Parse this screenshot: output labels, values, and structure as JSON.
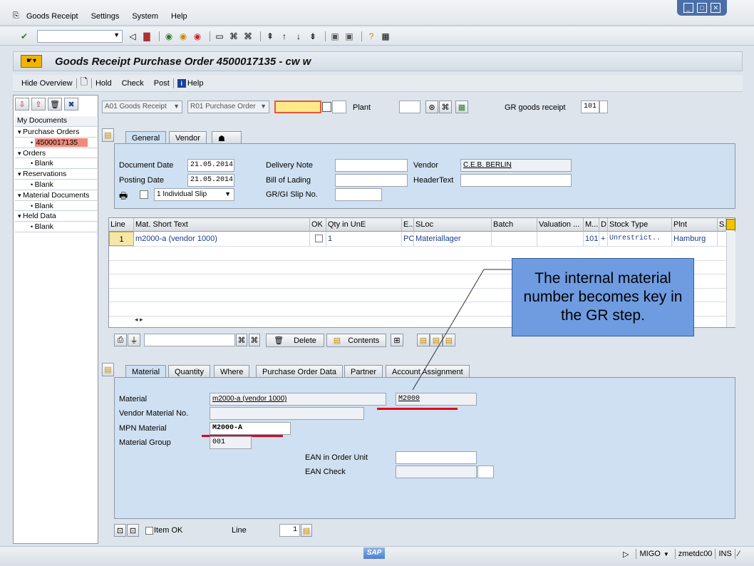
{
  "menu": [
    "Goods Receipt",
    "Settings",
    "System",
    "Help"
  ],
  "title": "Goods Receipt Purchase Order 4500017135 - cw w",
  "app_toolbar": [
    "Hide Overview",
    "Hold",
    "Check",
    "Post",
    "Help"
  ],
  "tree": {
    "title": "My Documents",
    "items": [
      {
        "label": "Purchase Orders",
        "level": 0
      },
      {
        "label": "4500017135",
        "level": 1,
        "selected": true
      },
      {
        "label": "Orders",
        "level": 0
      },
      {
        "label": "Blank",
        "level": 1
      },
      {
        "label": "Reservations",
        "level": 0
      },
      {
        "label": "Blank",
        "level": 1
      },
      {
        "label": "Material Documents",
        "level": 0
      },
      {
        "label": "Blank",
        "level": 1
      },
      {
        "label": "Held Data",
        "level": 0
      },
      {
        "label": "Blank",
        "level": 1
      }
    ]
  },
  "selectors": {
    "action": "A01 Goods Receipt",
    "ref_doc": "R01 Purchase Order",
    "plant_label": "Plant",
    "movement_label": "GR goods receipt",
    "movement_type": "101"
  },
  "header_tabs": [
    "General",
    "Vendor"
  ],
  "header": {
    "document_date_label": "Document Date",
    "document_date": "21.05.2014",
    "posting_date_label": "Posting Date",
    "posting_date": "21.05.2014",
    "slip": "1 Individual Slip",
    "delivery_note_label": "Delivery Note",
    "bill_of_lading_label": "Bill of Lading",
    "gr_slip_label": "GR/GI Slip No.",
    "vendor_label": "Vendor",
    "vendor": "C.E.B. BERLIN",
    "header_text_label": "HeaderText"
  },
  "grid": {
    "columns": [
      "Line",
      "Mat. Short Text",
      "OK",
      "Qty in UnE",
      "E...",
      "SLoc",
      "Batch",
      "Valuation ...",
      "M...",
      "D",
      "Stock Type",
      "Plnt",
      "S."
    ],
    "rows": [
      {
        "line": "1",
        "text": "m2000-a (vendor 1000)",
        "qty": "1",
        "unit": "PC",
        "sloc": "Materiallager",
        "mvt": "101",
        "d": "+",
        "stock": "Unrestrict..",
        "plant": "Hamburg"
      }
    ]
  },
  "item_toolbar": {
    "delete": "Delete",
    "contents": "Contents"
  },
  "detail_tabs": [
    "Material",
    "Quantity",
    "Where",
    "Purchase Order Data",
    "Partner",
    "Account Assignment"
  ],
  "detail": {
    "material_label": "Material",
    "material_text": "m2000-a (vendor 1000)",
    "material_number": "M2000",
    "vendor_material_label": "Vendor Material No.",
    "mpn_label": "MPN Material",
    "mpn": "M2000-A",
    "material_group_label": "Material Group",
    "material_group": "001",
    "ean_unit_label": "EAN in Order Unit",
    "ean_check_label": "EAN Check"
  },
  "footer": {
    "item_ok": "Item OK",
    "line_label": "Line",
    "line": "1"
  },
  "callout": "The internal material number becomes key in the GR step.",
  "status": {
    "tx": "MIGO",
    "server": "zmetdc00",
    "mode": "INS",
    "logo": "SAP"
  },
  "colors": {
    "accent_red": "#e0001a",
    "selected": "#f08a7a",
    "callout": "#6f9be0"
  }
}
